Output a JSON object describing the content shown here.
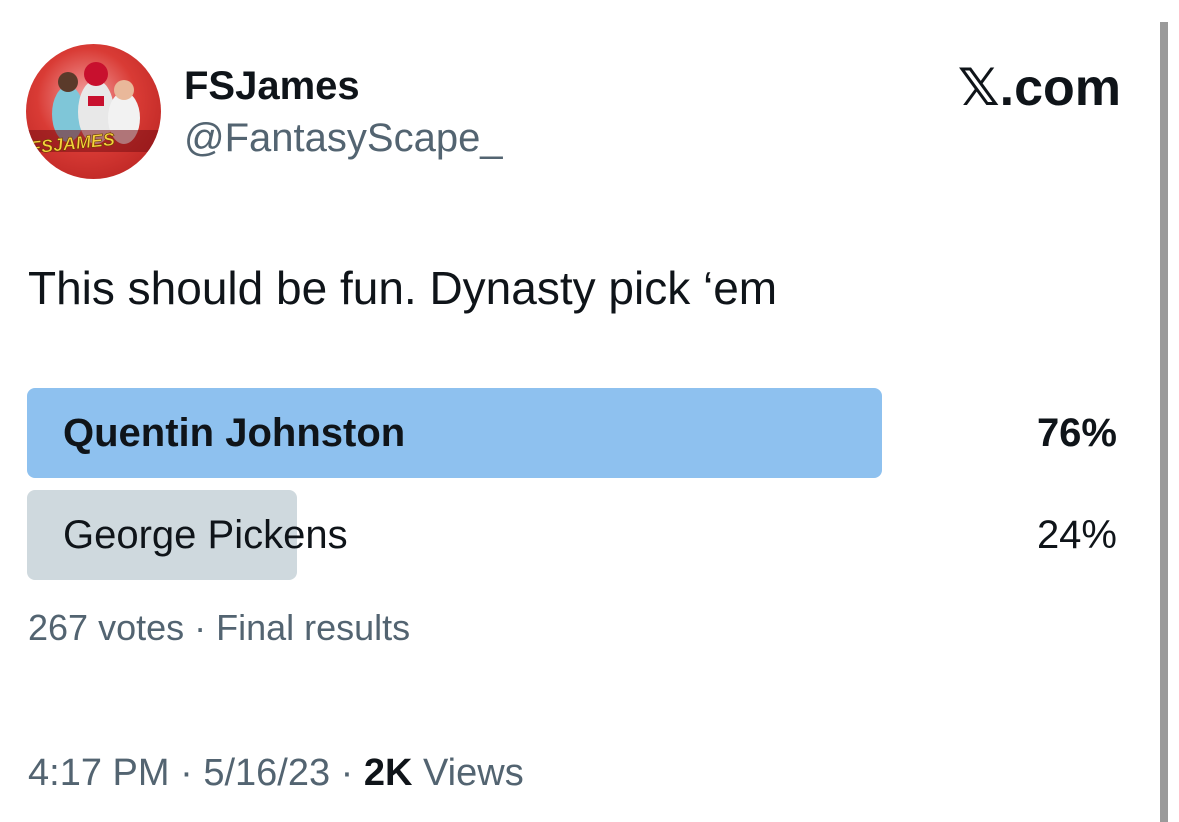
{
  "author": {
    "display_name": "FSJames",
    "handle": "@FantasyScape_",
    "avatar_icon": "profile-avatar",
    "avatar_text": "FSJAMES"
  },
  "brand": {
    "label": "𝕏.com"
  },
  "tweet": {
    "text": "This should be fun. Dynasty pick ‘em"
  },
  "poll": {
    "options": [
      {
        "label": "Quentin Johnston",
        "percent_label": "76%",
        "percent": 76,
        "winner": true,
        "fill_color": "#8ec1ef"
      },
      {
        "label": "George Pickens",
        "percent_label": "24%",
        "percent": 24,
        "winner": false,
        "fill_color": "#cfd9de"
      }
    ],
    "summary": "267 votes · Final results"
  },
  "meta": {
    "time": "4:17 PM",
    "sep1": " · ",
    "date": "5/16/23",
    "sep2": " · ",
    "views_count": "2K",
    "views_label": " Views"
  }
}
